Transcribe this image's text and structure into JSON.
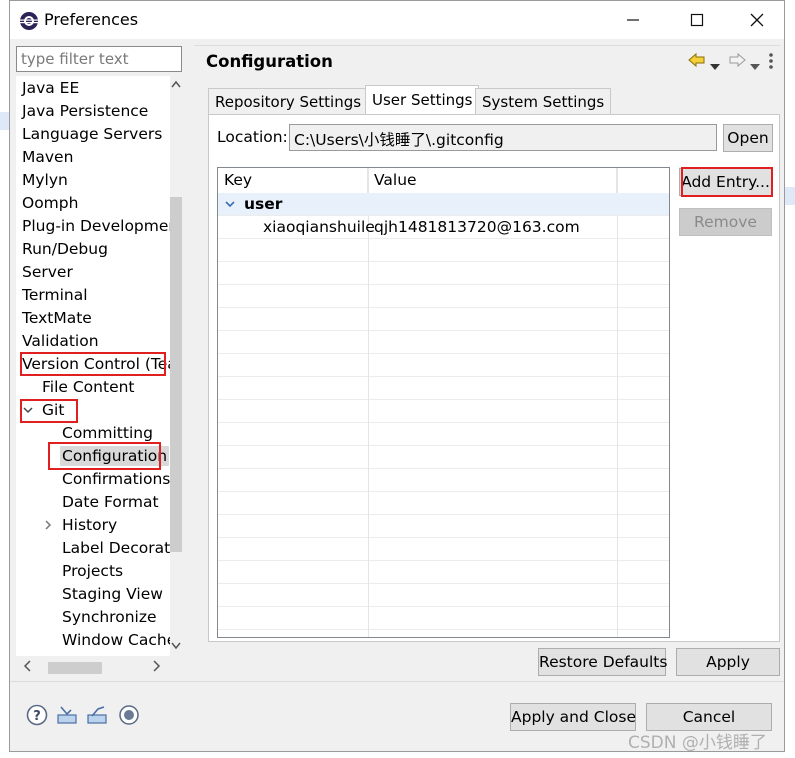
{
  "window": {
    "title": "Preferences"
  },
  "filter": {
    "placeholder": "type filter text"
  },
  "tree": {
    "items": [
      {
        "label": "Java EE",
        "indent": 0
      },
      {
        "label": "Java Persistence",
        "indent": 0
      },
      {
        "label": "Language Servers",
        "indent": 0
      },
      {
        "label": "Maven",
        "indent": 0
      },
      {
        "label": "Mylyn",
        "indent": 0
      },
      {
        "label": "Oomph",
        "indent": 0
      },
      {
        "label": "Plug-in Developmer",
        "indent": 0
      },
      {
        "label": "Run/Debug",
        "indent": 0
      },
      {
        "label": "Server",
        "indent": 0
      },
      {
        "label": "Terminal",
        "indent": 0
      },
      {
        "label": "TextMate",
        "indent": 0
      },
      {
        "label": "Validation",
        "indent": 0
      },
      {
        "label": "Version Control (Tea",
        "indent": 0
      },
      {
        "label": "File Content",
        "indent": 1
      },
      {
        "label": "Git",
        "indent": 1,
        "expanded": true
      },
      {
        "label": "Committing",
        "indent": 2
      },
      {
        "label": "Configuration",
        "indent": 2,
        "selected": true
      },
      {
        "label": "Confirmations",
        "indent": 2
      },
      {
        "label": "Date Format",
        "indent": 2
      },
      {
        "label": "History",
        "indent": 2,
        "collapsed": true
      },
      {
        "label": "Label Decorati",
        "indent": 2
      },
      {
        "label": "Projects",
        "indent": 2
      },
      {
        "label": "Staging View",
        "indent": 2
      },
      {
        "label": "Synchronize",
        "indent": 2
      },
      {
        "label": "Window Cache",
        "indent": 2
      }
    ]
  },
  "page": {
    "title": "Configuration"
  },
  "tabs": [
    {
      "label": "Repository Settings"
    },
    {
      "label": "User Settings",
      "active": true
    },
    {
      "label": "System Settings"
    }
  ],
  "location": {
    "label": "Location:",
    "value": "C:\\Users\\小钱睡了\\.gitconfig",
    "open_label": "Open"
  },
  "table": {
    "headers": [
      "Key",
      "Value"
    ],
    "rows": [
      {
        "key": "user",
        "value": "",
        "group": true
      },
      {
        "key": "xiaoqianshuile",
        "value": "qjh1481813720@163.com",
        "group": false
      }
    ]
  },
  "buttons": {
    "add_entry": "Add Entry...",
    "remove": "Remove",
    "restore_defaults": "Restore Defaults",
    "apply": "Apply",
    "apply_and_close": "Apply and Close",
    "cancel": "Cancel"
  },
  "icons": {
    "help": "help-icon",
    "import": "import-icon",
    "export": "export-icon",
    "record": "record-icon"
  },
  "colors": {
    "highlight_box": "#e02020",
    "selection": "#cce8ff",
    "group_row": "#e8f1fb"
  },
  "watermark": "CSDN @小钱睡了"
}
